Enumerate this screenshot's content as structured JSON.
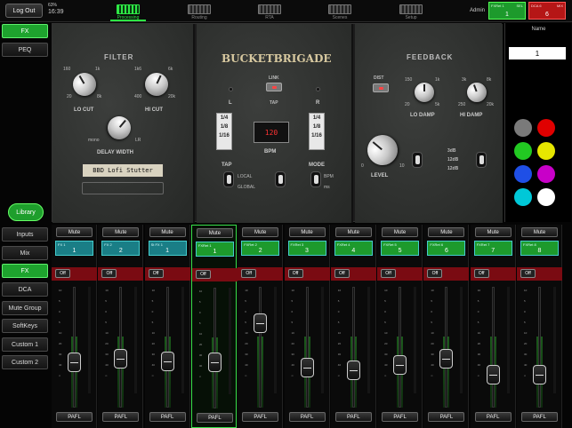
{
  "topbar": {
    "logout_label": "Log Out",
    "battery": "63%",
    "time": "16:39",
    "tabs": [
      {
        "label": "Processing",
        "active": true
      },
      {
        "label": "Routing",
        "active": false
      },
      {
        "label": "RTA",
        "active": false
      },
      {
        "label": "Scenes",
        "active": false
      },
      {
        "label": "Setup",
        "active": false
      }
    ],
    "user": "Admin",
    "selected_channel": {
      "name": "FXRet 1",
      "tag": "SEL",
      "number": "1",
      "color": "#1d9a2c"
    },
    "selected_dca": {
      "name": "DCA 6",
      "tag": "MIX",
      "number": "6",
      "color": "#b51616"
    }
  },
  "left_top_buttons": [
    {
      "label": "FX",
      "active": true
    },
    {
      "label": "PEQ",
      "active": false
    }
  ],
  "library_label": "Library",
  "left_bottom_buttons": [
    {
      "label": "Inputs",
      "active": false
    },
    {
      "label": "Mix",
      "active": false
    },
    {
      "label": "FX",
      "active": true
    },
    {
      "label": "DCA",
      "active": false
    },
    {
      "label": "Mute Group",
      "active": false
    },
    {
      "label": "SoftKeys",
      "active": false
    },
    {
      "label": "Custom 1",
      "active": false
    },
    {
      "label": "Custom 2",
      "active": false
    }
  ],
  "plugin": {
    "name": "BUCKETBRIGADE",
    "filter": {
      "title": "FILTER",
      "lo_cut_label": "LO CUT",
      "hi_cut_label": "HI CUT",
      "lo_ticks": [
        "160",
        "1k",
        "20",
        "8k"
      ],
      "hi_ticks": [
        "1k6",
        "6k",
        "400",
        "20k"
      ],
      "delay_width_label": "DELAY WIDTH",
      "mono_label": "mono",
      "lr_label": "LR",
      "preset_name": "BBD Lofi Stutter"
    },
    "center": {
      "link_label": "LINK",
      "tap_label": "TAP",
      "left_label": "L",
      "right_label": "R",
      "note_values": [
        "1/4",
        "1/8",
        "1/16"
      ],
      "bpm_value": "120",
      "bpm_label": "BPM",
      "tap_mode_label": "TAP",
      "local_label": "LOCAL",
      "global_label": "GLOBAL",
      "mode_label": "MODE",
      "bpm_mode_label": "BPM",
      "ms_label": "ms"
    },
    "feedback": {
      "title": "FEEDBACK",
      "dist_label": "DIST",
      "lo_damp_label": "LO DAMP",
      "hi_damp_label": "HI DAMP",
      "lo_ticks": [
        "150",
        "1k",
        "20",
        "5k"
      ],
      "hi_ticks": [
        "3k",
        "8k",
        "250",
        "20k"
      ],
      "level_label": "LEVEL",
      "level_min": "0",
      "level_max": "10",
      "range_options": [
        "3dB",
        "12dB",
        "12dB"
      ]
    }
  },
  "name_panel": {
    "label": "Name",
    "value": "1",
    "colors": [
      "#7a7a7a",
      "#e00000",
      "#22c922",
      "#e6e600",
      "#1f4fe6",
      "#c800c8",
      "#00c8d8",
      "#ffffff"
    ]
  },
  "strips": [
    {
      "mute": "Mute",
      "name": "FX 1",
      "number": "1",
      "color": "#1a7e86",
      "off": "Off",
      "pafl": "PAFL",
      "level": 0.38,
      "selected": false
    },
    {
      "mute": "Mute",
      "name": "FX 2",
      "number": "2",
      "color": "#1a7e86",
      "off": "Off",
      "pafl": "PAFL",
      "level": 0.42,
      "selected": false
    },
    {
      "mute": "Mute",
      "name": "St FX 1",
      "number": "1",
      "color": "#1a7e86",
      "off": "Off",
      "pafl": "PAFL",
      "level": 0.39,
      "selected": false
    },
    {
      "mute": "Mute",
      "name": "FXRet 1",
      "number": "1",
      "color": "#1d9a2c",
      "off": "Off",
      "pafl": "PAFL",
      "level": 0.39,
      "selected": true
    },
    {
      "mute": "Mute",
      "name": "FXRet 2",
      "number": "2",
      "color": "#1d9a2c",
      "off": "Off",
      "pafl": "PAFL",
      "level": 0.75,
      "selected": false
    },
    {
      "mute": "Mute",
      "name": "FXRet 3",
      "number": "3",
      "color": "#1d9a2c",
      "off": "Off",
      "pafl": "PAFL",
      "level": 0.33,
      "selected": false
    },
    {
      "mute": "Mute",
      "name": "FXRet 4",
      "number": "4",
      "color": "#1d9a2c",
      "off": "Off",
      "pafl": "PAFL",
      "level": 0.31,
      "selected": false
    },
    {
      "mute": "Mute",
      "name": "FXRet 5",
      "number": "5",
      "color": "#1d9a2c",
      "off": "Off",
      "pafl": "PAFL",
      "level": 0.36,
      "selected": false
    },
    {
      "mute": "Mute",
      "name": "FXRet 6",
      "number": "6",
      "color": "#1d9a2c",
      "off": "Off",
      "pafl": "PAFL",
      "level": 0.42,
      "selected": false
    },
    {
      "mute": "Mute",
      "name": "FXRet 7",
      "number": "7",
      "color": "#1d9a2c",
      "off": "Off",
      "pafl": "PAFL",
      "level": 0.27,
      "selected": false
    },
    {
      "mute": "Mute",
      "name": "FXRet 8",
      "number": "8",
      "color": "#1d9a2c",
      "off": "Off",
      "pafl": "PAFL",
      "level": 0.27,
      "selected": false
    }
  ],
  "fader_scale": [
    "10",
    "5",
    "0",
    "5",
    "10",
    "20",
    "30",
    "40",
    "∞"
  ]
}
